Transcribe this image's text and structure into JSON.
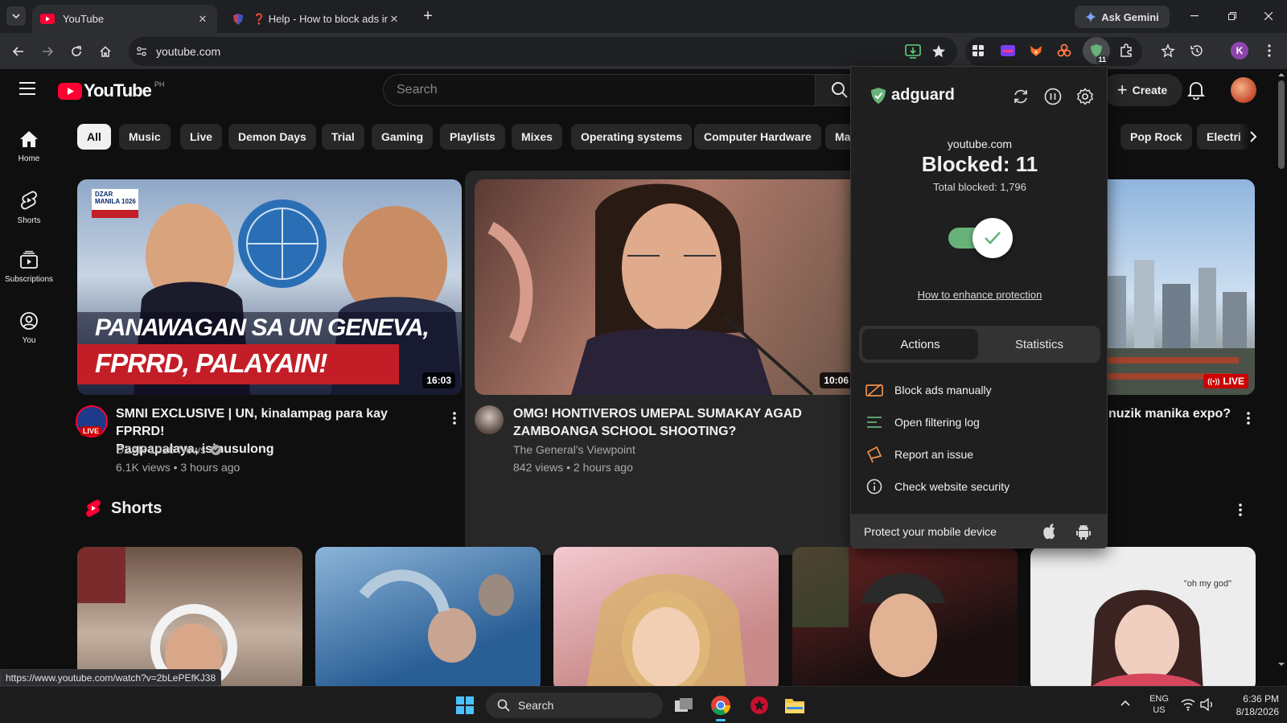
{
  "browser": {
    "tabs": [
      {
        "title": "YouTube",
        "active": true
      },
      {
        "title": "❓ Help - How to block ads in g",
        "active": false
      }
    ],
    "new_tab_label": "+",
    "ask_gemini_label": "Ask Gemini",
    "url": "youtube.com",
    "ext_badge_count": "11",
    "profile_initial": "K",
    "status_url": "https://www.youtube.com/watch?v=2bLePEfKJ38"
  },
  "youtube": {
    "logo_text": "YouTube",
    "region": "PH",
    "search_placeholder": "Search",
    "create_label": "Create",
    "nav": [
      {
        "label": "Home",
        "icon": "home-icon"
      },
      {
        "label": "Shorts",
        "icon": "shorts-icon"
      },
      {
        "label": "Subscriptions",
        "icon": "subscriptions-icon"
      },
      {
        "label": "You",
        "icon": "you-icon"
      }
    ],
    "chips": [
      "All",
      "Music",
      "Live",
      "Demon Days",
      "Trial",
      "Gaming",
      "Playlists",
      "Mixes",
      "Operating systems",
      "Computer Hardware",
      "Ma",
      "Pop Rock",
      "Electri"
    ],
    "videos": [
      {
        "title_line1": "SMNI EXCLUSIVE | UN, kinalampag para kay FPRRD!",
        "title_line2": "Pagpapalaya, isinusulong",
        "channel": "DZAR 1026 News",
        "meta": "6.1K views • 3 hours ago",
        "duration": "16:03",
        "thumb_line1": "PANAWAGAN SA UN GENEVA,",
        "thumb_line2": "FPRRD, PALAYAIN!",
        "thumb_logo": "DZAR MANILA 1026",
        "avatar_badge": "LIVE"
      },
      {
        "title_line1": "OMG! HONTIVEROS UMEPAL SUMAKAY AGAD",
        "title_line2": "ZAMBOANGA SCHOOL SHOOTING?",
        "channel": "The General's Viewpoint",
        "meta": "842 views • 2 hours ago",
        "duration": "10:06"
      },
      {
        "title_line1": "nuzik manika expo?",
        "live_badge": "LIVE"
      }
    ],
    "shorts_heading": "Shorts",
    "shorts_caption_5": "\"oh my god\""
  },
  "adguard": {
    "brand": "adguard",
    "site": "youtube.com",
    "blocked": "Blocked: 11",
    "total_blocked": "Total blocked: 1,796",
    "protection_enabled": true,
    "enhance_link": "How to enhance protection",
    "tabs": [
      "Actions",
      "Statistics"
    ],
    "active_tab": "Actions",
    "actions": [
      {
        "label": "Block ads manually",
        "icon": "block-ads-icon"
      },
      {
        "label": "Open filtering log",
        "icon": "filtering-log-icon"
      },
      {
        "label": "Report an issue",
        "icon": "megaphone-icon"
      },
      {
        "label": "Check website security",
        "icon": "info-icon"
      }
    ],
    "footer": "Protect your mobile device",
    "colors": {
      "accent": "#67b279",
      "orange": "#f28f4b"
    }
  },
  "taskbar": {
    "search_label": "Search",
    "lang": "ENG",
    "region": "US",
    "time": "6:36 PM",
    "date": "8/18/2026"
  }
}
